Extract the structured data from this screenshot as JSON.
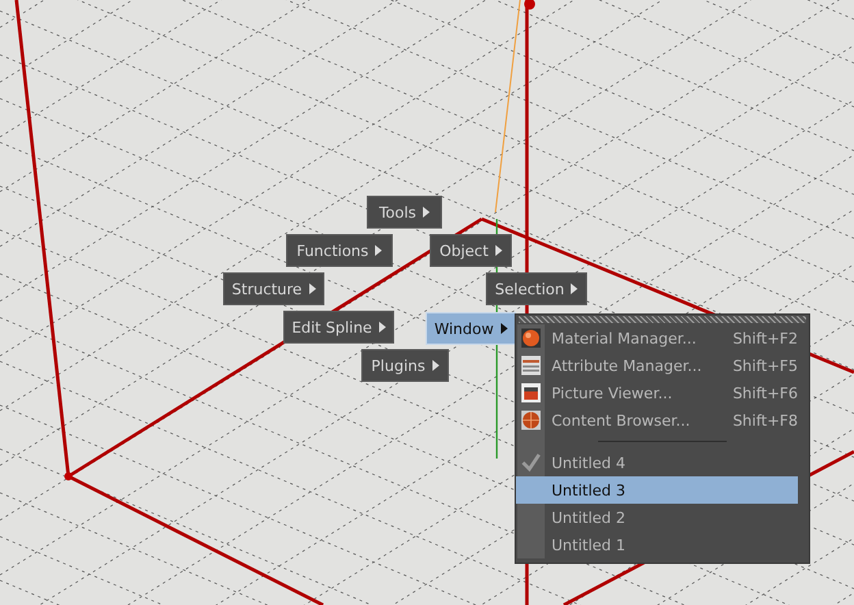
{
  "menu_buttons": [
    {
      "label": "Tools",
      "selected": false
    },
    {
      "label": "Functions",
      "selected": false
    },
    {
      "label": "Object",
      "selected": false
    },
    {
      "label": "Structure",
      "selected": false
    },
    {
      "label": "Selection",
      "selected": false
    },
    {
      "label": "Edit Spline",
      "selected": false
    },
    {
      "label": "Window",
      "selected": true
    },
    {
      "label": "Plugins",
      "selected": false
    }
  ],
  "submenu": {
    "commands": [
      {
        "label": "Material Manager...",
        "shortcut": "Shift+F2",
        "kind": "sphere"
      },
      {
        "label": "Attribute Manager...",
        "shortcut": "Shift+F5",
        "kind": "list"
      },
      {
        "label": "Picture Viewer...",
        "shortcut": "Shift+F6",
        "kind": "picture"
      },
      {
        "label": "Content Browser...",
        "shortcut": "Shift+F8",
        "kind": "globe"
      }
    ],
    "documents": [
      {
        "label": "Untitled 4",
        "checked": true,
        "selected": false
      },
      {
        "label": "Untitled 3",
        "checked": false,
        "selected": true
      },
      {
        "label": "Untitled 2",
        "checked": false,
        "selected": false
      },
      {
        "label": "Untitled 1",
        "checked": false,
        "selected": false
      }
    ]
  }
}
